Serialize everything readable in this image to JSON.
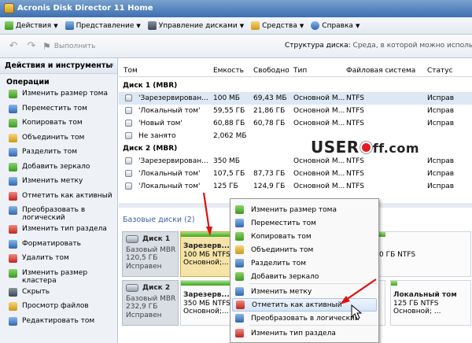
{
  "window": {
    "title": "Acronis Disk Director 11 Home"
  },
  "menu": [
    {
      "label": "Действия",
      "icon": "actions-icon"
    },
    {
      "label": "Представление",
      "icon": "view-icon"
    },
    {
      "label": "Управление дисками",
      "icon": "disk-management-icon"
    },
    {
      "label": "Средства",
      "icon": "tools-icon"
    },
    {
      "label": "Справка",
      "icon": "help-icon"
    }
  ],
  "toolbar": {
    "run_label": "Выполнить",
    "structure_label": "Структура диска:",
    "structure_value": "Среда, в которой можно использо"
  },
  "sidebar": {
    "title": "Действия и инструменты",
    "section": "Операции",
    "items": [
      {
        "label": "Изменить размер тома",
        "icon": "resize-volume-icon",
        "color": "g"
      },
      {
        "label": "Переместить том",
        "icon": "move-volume-icon",
        "color": "b"
      },
      {
        "label": "Копировать том",
        "icon": "copy-volume-icon",
        "color": "g"
      },
      {
        "label": "Объединить том",
        "icon": "merge-volume-icon",
        "color": "y"
      },
      {
        "label": "Разделить том",
        "icon": "split-volume-icon",
        "color": "b"
      },
      {
        "label": "Добавить зеркало",
        "icon": "add-mirror-icon",
        "color": "g"
      },
      {
        "label": "Изменить метку",
        "icon": "change-label-icon",
        "color": "b"
      },
      {
        "label": "Отметить как активный",
        "icon": "mark-active-icon",
        "color": "r"
      },
      {
        "label": "Преобразовать в логический",
        "icon": "convert-logical-icon",
        "color": "b"
      },
      {
        "label": "Изменить тип раздела",
        "icon": "change-partition-type-icon",
        "color": "r"
      },
      {
        "label": "Форматировать",
        "icon": "format-icon",
        "color": "b"
      },
      {
        "label": "Удалить том",
        "icon": "delete-volume-icon",
        "color": "r"
      },
      {
        "label": "Изменить размер кластера",
        "icon": "cluster-size-icon",
        "color": "g"
      },
      {
        "label": "Скрыть",
        "icon": "hide-icon",
        "color": "k"
      },
      {
        "label": "Просмотр файлов",
        "icon": "browse-files-icon",
        "color": "y"
      },
      {
        "label": "Редактировать том",
        "icon": "edit-volume-icon",
        "color": "b"
      }
    ]
  },
  "table": {
    "columns": [
      "Том",
      "Емкость",
      "Свободно",
      "Тип",
      "Файловая система",
      "Статус"
    ],
    "groups": [
      {
        "title": "Диск 1 (MBR)",
        "rows": [
          {
            "name": "'Зарезервирован...",
            "capacity": "100 МБ",
            "free": "69,43 МБ",
            "type": "Основной М...",
            "fs": "NTFS",
            "status": "Исправ",
            "selected": true
          },
          {
            "name": "'Локальный том'",
            "capacity": "59,55 ГБ",
            "free": "21,86 ГБ",
            "type": "Основной М...",
            "fs": "NTFS",
            "status": "Исправ",
            "selected": false
          },
          {
            "name": "'Новый том'",
            "capacity": "60,88 ГБ",
            "free": "60,78 ГБ",
            "type": "Основной М...",
            "fs": "NTFS",
            "status": "Исправ",
            "selected": false
          },
          {
            "name": "Не занято",
            "capacity": "2,062 МБ",
            "free": "",
            "type": "",
            "fs": "",
            "status": "",
            "selected": false
          }
        ]
      },
      {
        "title": "Диск 2 (MBR)",
        "rows": [
          {
            "name": "'Зарезервирован...",
            "capacity": "350 МБ",
            "free": "",
            "type": "Основной М...",
            "fs": "NTFS",
            "status": "Исправ",
            "selected": false
          },
          {
            "name": "'Локальный том'",
            "capacity": "107,5 ГБ",
            "free": "87,73 ГБ",
            "type": "Основной М...",
            "fs": "NTFS",
            "status": "Исправ",
            "selected": false
          },
          {
            "name": "'Локальный том'",
            "capacity": "125 ГБ",
            "free": "124,9 ГБ",
            "type": "Основной М...",
            "fs": "NTFS",
            "status": "Исправ",
            "selected": false
          }
        ]
      }
    ]
  },
  "basic_disks": {
    "title": "Базовые диски (2)",
    "disks": [
      {
        "name": "Диск 1",
        "kind": "Базовый MBR",
        "size": "120,5 ГБ",
        "status": "Исправен",
        "parts": [
          {
            "name": "Зарезерв...",
            "size": "100 МБ NTFS",
            "type": "Основной;..."
          },
          {
            "name": "",
            "size": "0 ГБ NTFS",
            "type": ""
          }
        ]
      },
      {
        "name": "Диск 2",
        "kind": "Базовый MBR",
        "size": "232,9 ГБ",
        "status": "Исправен",
        "parts": [
          {
            "name": "Зарезерв...",
            "size": "350 МБ NTFS",
            "type": "Основной;..."
          },
          {
            "name": "Локальный том",
            "size": "125 ГБ NTFS",
            "type": "Основной; ..."
          }
        ]
      }
    ]
  },
  "context_menu": {
    "items": [
      {
        "label": "Изменить размер тома",
        "icon": "resize-volume-icon",
        "color": "g"
      },
      {
        "label": "Переместить том",
        "icon": "move-volume-icon",
        "color": "b"
      },
      {
        "label": "Копировать том",
        "icon": "copy-volume-icon",
        "color": "g"
      },
      {
        "label": "Объединить том",
        "icon": "merge-volume-icon",
        "color": "y"
      },
      {
        "label": "Разделить том",
        "icon": "split-volume-icon",
        "color": "b"
      },
      {
        "label": "Добавить зеркало",
        "icon": "add-mirror-icon",
        "color": "g"
      },
      {
        "label": "Изменить метку",
        "icon": "change-label-icon",
        "color": "b"
      },
      {
        "label": "Отметить как активный",
        "icon": "mark-active-icon",
        "color": "r",
        "hover": true
      },
      {
        "label": "Преобразовать в логический",
        "icon": "convert-logical-icon",
        "color": "b"
      },
      {
        "label": "Изменить тип раздела",
        "icon": "change-partition-type-icon",
        "color": "r"
      }
    ]
  },
  "watermark": {
    "text_before": "USER",
    "text_after": "ff.com"
  }
}
